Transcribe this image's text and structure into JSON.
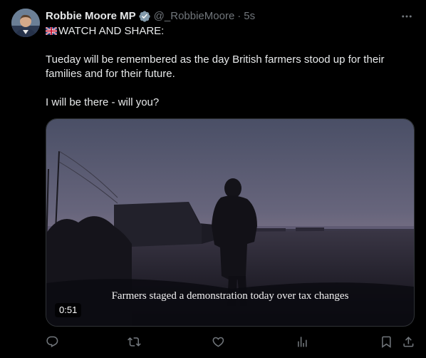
{
  "author": {
    "display_name": "Robbie Moore MP",
    "handle": "@_RobbieMoore",
    "separator": "·",
    "time": "5s",
    "avatar_icon": "avatar",
    "verified_icon": "verified-badge-icon"
  },
  "tweet": {
    "line1_text": "WATCH AND SHARE:",
    "flag_icon": "uk-flag-icon",
    "paragraph2": "Tueday will be remembered as the day British farmers stood up for their families and for their future.",
    "paragraph3": "I will be there - will you?"
  },
  "media": {
    "caption": "Farmers staged a demonstration today over tax changes",
    "duration": "0:51"
  },
  "actions": [
    "reply-icon",
    "retweet-icon",
    "like-icon",
    "views-icon",
    "bookmark-icon",
    "share-icon"
  ],
  "colors": {
    "background": "#000000",
    "text": "#e7e9ea",
    "muted": "#71767b",
    "verified": "#829aab",
    "border": "#2f3336"
  }
}
